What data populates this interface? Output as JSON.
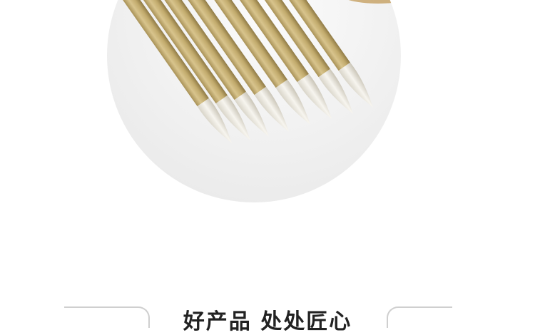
{
  "section": {
    "title": "好产品 处处匠心"
  },
  "photo": {
    "subject": "calligraphy-brushes"
  },
  "colors": {
    "title_text": "#222222",
    "deco_line": "#cfcfcf",
    "bamboo": "#c9b277",
    "bristle": "#efece3"
  }
}
